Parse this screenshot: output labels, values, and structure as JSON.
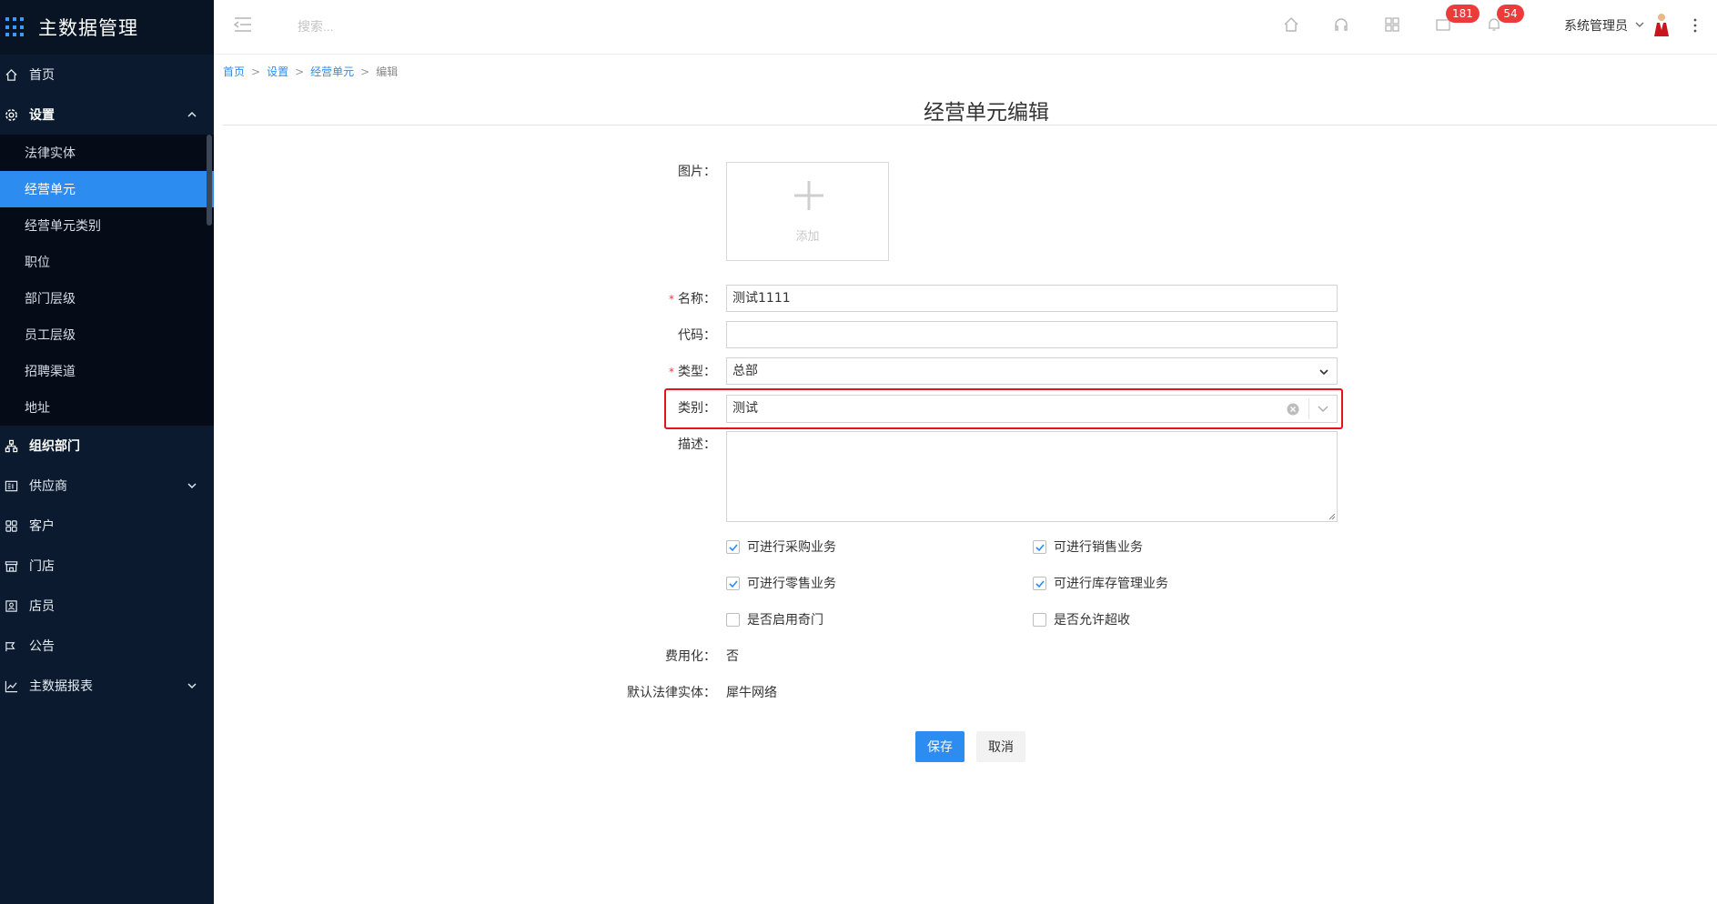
{
  "app": {
    "title": "主数据管理"
  },
  "sidebar": {
    "items": [
      {
        "label": "首页",
        "icon": "home-icon"
      },
      {
        "label": "设置",
        "icon": "gear-icon",
        "expanded": true,
        "children": [
          {
            "label": "法律实体"
          },
          {
            "label": "经营单元",
            "active": true
          },
          {
            "label": "经营单元类别"
          },
          {
            "label": "职位"
          },
          {
            "label": "部门层级"
          },
          {
            "label": "员工层级"
          },
          {
            "label": "招聘渠道"
          },
          {
            "label": "地址"
          }
        ]
      },
      {
        "label": "组织部门",
        "icon": "org-icon"
      },
      {
        "label": "供应商",
        "icon": "supplier-icon",
        "expandable": true
      },
      {
        "label": "客户",
        "icon": "customer-icon"
      },
      {
        "label": "门店",
        "icon": "store-icon"
      },
      {
        "label": "店员",
        "icon": "clerk-icon"
      },
      {
        "label": "公告",
        "icon": "announcement-icon"
      },
      {
        "label": "主数据报表",
        "icon": "report-icon",
        "expandable": true
      }
    ]
  },
  "header": {
    "search_placeholder": "搜索...",
    "mail_badge": "181",
    "bell_badge": "54",
    "user_name": "系统管理员"
  },
  "breadcrumb": {
    "home": "首页",
    "settings": "设置",
    "unit": "经营单元",
    "current": "编辑",
    "sep": ">"
  },
  "page": {
    "title": "经营单元编辑"
  },
  "form": {
    "image_label": "图片：",
    "upload_text": "添加",
    "name_label": "名称：",
    "name_value": "测试1111",
    "code_label": "代码：",
    "code_value": "",
    "type_label": "类型：",
    "type_value": "总部",
    "category_label": "类别：",
    "category_value": "测试",
    "desc_label": "描述：",
    "checkboxes": {
      "purchase": {
        "label": "可进行采购业务",
        "checked": true
      },
      "sales": {
        "label": "可进行销售业务",
        "checked": true
      },
      "retail": {
        "label": "可进行零售业务",
        "checked": true
      },
      "inventory": {
        "label": "可进行库存管理业务",
        "checked": true
      },
      "odd_door": {
        "label": "是否启用奇门",
        "checked": false
      },
      "over_receive": {
        "label": "是否允许超收",
        "checked": false
      }
    },
    "expense_label": "费用化：",
    "expense_value": "否",
    "legal_entity_label": "默认法律实体：",
    "legal_entity_value": "犀牛网络",
    "save_label": "保存",
    "cancel_label": "取消"
  },
  "colors": {
    "accent": "#2d8cf0",
    "sidebar_bg": "#0b1a2e",
    "badge": "#ed3b3b",
    "highlight": "#e5131b"
  }
}
